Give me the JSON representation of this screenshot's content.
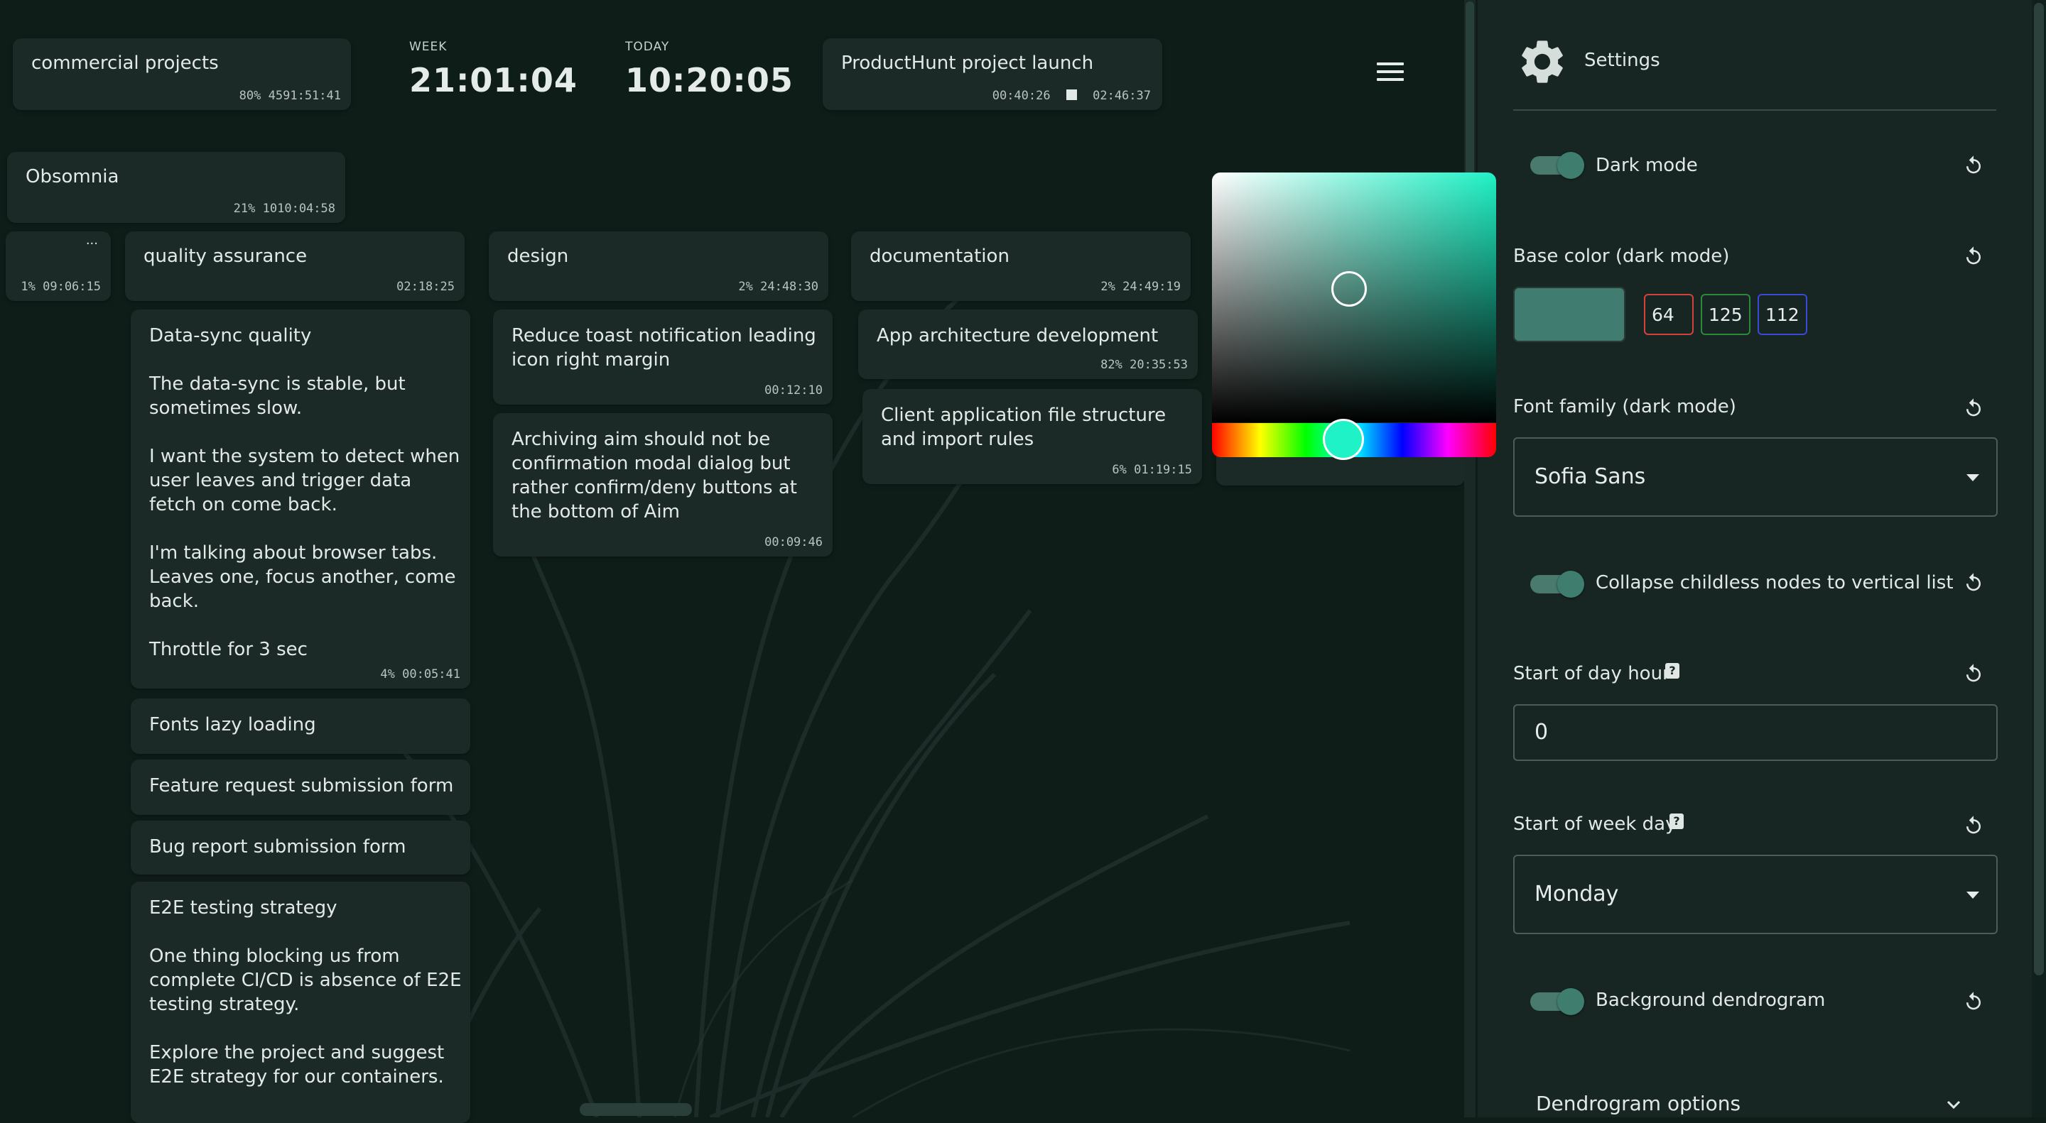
{
  "header": {
    "project_card": {
      "title": "commercial projects",
      "percent": "80%",
      "time": "4591:51:41"
    },
    "week": {
      "label": "WEEK",
      "value": "21:01:04"
    },
    "today": {
      "label": "TODAY",
      "value": "10:20:05"
    },
    "active_task": {
      "title": "ProductHunt project launch",
      "elapsed": "00:40:26",
      "total": "02:46:37"
    }
  },
  "tree": {
    "root": {
      "title": "Obsomnia",
      "percent": "21%",
      "time": "1010:04:58"
    },
    "collapsed": {
      "ellipsis": "...",
      "percent": "1%",
      "time": "09:06:15"
    },
    "qa": {
      "title": "quality assurance",
      "time": "02:18:25",
      "tasks": [
        {
          "title": "Data-sync quality\n\nThe data-sync is stable, but sometimes slow.\n\nI want the system to detect when user leaves and trigger data fetch on come back.\n\nI'm talking about browser tabs. Leaves one, focus another, come back.\n\nThrottle for 3 sec",
          "meta": "4% 00:05:41"
        },
        {
          "title": "Fonts lazy loading"
        },
        {
          "title": "Feature request submission form"
        },
        {
          "title": "Bug report submission form"
        },
        {
          "title": "E2E testing strategy\n\nOne thing blocking us from complete CI/CD is absence of E2E testing strategy.\n\nExplore the project and suggest E2E strategy for our containers."
        }
      ]
    },
    "design": {
      "title": "design",
      "percent": "2%",
      "time": "24:48:30",
      "tasks": [
        {
          "title": "Reduce toast notification leading icon right margin",
          "meta": "00:12:10"
        },
        {
          "title": "Archiving aim should not be confirmation modal dialog but rather confirm/deny buttons at the bottom of Aim",
          "meta": "00:09:46"
        }
      ]
    },
    "documentation": {
      "title": "documentation",
      "percent": "2%",
      "time": "24:49:19",
      "tasks": [
        {
          "title": "App architecture development",
          "meta": "82% 20:35:53"
        },
        {
          "title": "Client application file structure and import rules",
          "meta": "6% 01:19:15"
        }
      ]
    }
  },
  "color_picker": {
    "hue_color": "#1ff2c6"
  },
  "settings": {
    "title": "Settings",
    "dark_mode": {
      "label": "Dark mode",
      "on": true
    },
    "base_color": {
      "label": "Base color (dark mode)",
      "hex": "#407d70",
      "r": "64",
      "g": "125",
      "b": "112"
    },
    "font_family": {
      "label": "Font family (dark mode)",
      "value": "Sofia Sans"
    },
    "collapse_childless": {
      "label": "Collapse childless nodes to vertical list",
      "on": true
    },
    "start_of_day": {
      "label": "Start of day hour",
      "help": "?",
      "value": "0"
    },
    "start_of_week": {
      "label": "Start of week day",
      "help": "?",
      "value": "Monday"
    },
    "background_dendrogram": {
      "label": "Background dendrogram",
      "on": true
    },
    "dendrogram_options": {
      "label": "Dendrogram options"
    }
  }
}
